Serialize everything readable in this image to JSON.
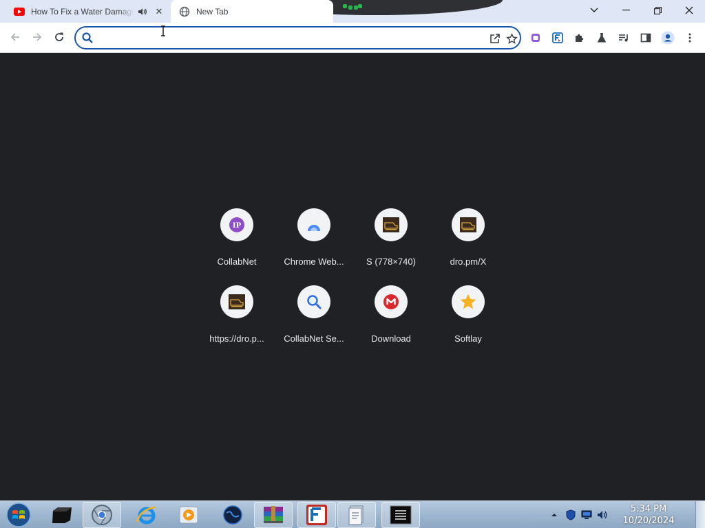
{
  "browser": {
    "tabs": [
      {
        "title": "How To Fix a Water Damaged",
        "favicon": "youtube-icon",
        "audio": true,
        "active": false
      },
      {
        "title": "New Tab",
        "favicon": "globe-icon",
        "audio": false,
        "active": true
      }
    ],
    "omnibox": {
      "value": "",
      "placeholder": ""
    },
    "colors": {
      "accent": "#1a56a7",
      "tabstrip": "#dfe6f5",
      "ntp_background": "#202124"
    }
  },
  "shortcuts": [
    {
      "title": "CollabNet",
      "icon": "ip-icon"
    },
    {
      "title": "Chrome Web...",
      "icon": "chrome-web-store-icon"
    },
    {
      "title": "S (778×740)",
      "icon": "site-thumbnail-icon"
    },
    {
      "title": "dro.pm/X",
      "icon": "site-thumbnail-icon"
    },
    {
      "title": "https://dro.p...",
      "icon": "site-thumbnail-icon"
    },
    {
      "title": "CollabNet Se...",
      "icon": "magnifier-icon"
    },
    {
      "title": "Download",
      "icon": "mega-icon"
    },
    {
      "title": "Softlay",
      "icon": "star-icon"
    }
  ],
  "taskbar": {
    "time": "5:34 PM",
    "date": "10/20/2024",
    "items": [
      "windows-start-icon",
      "terminal-box-icon",
      "chrome-icon",
      "internet-explorer-icon",
      "media-player-icon",
      "globe-app-icon",
      "winrar-icon",
      "filezilla-icon",
      "document-app-icon",
      "cmd-icon"
    ]
  }
}
